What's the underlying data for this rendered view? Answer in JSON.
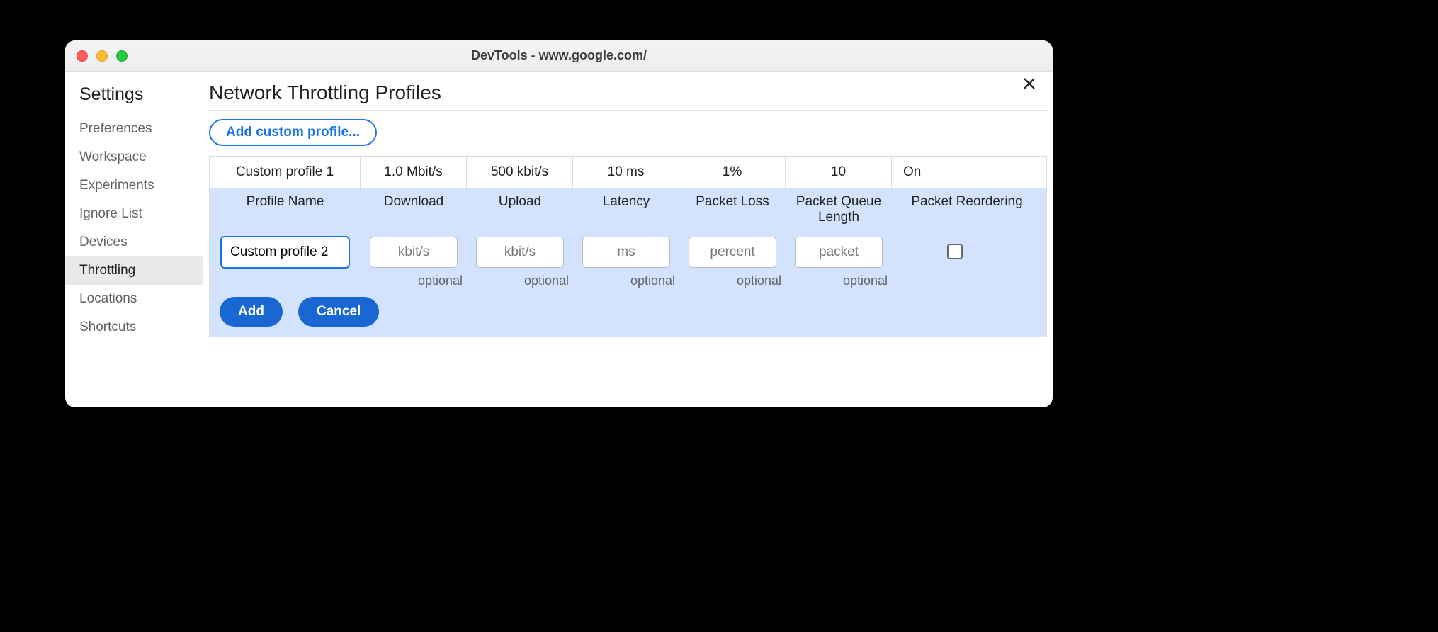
{
  "window_title": "DevTools - www.google.com/",
  "sidebar": {
    "heading": "Settings",
    "items": [
      "Preferences",
      "Workspace",
      "Experiments",
      "Ignore List",
      "Devices",
      "Throttling",
      "Locations",
      "Shortcuts"
    ],
    "active_index": 5
  },
  "page": {
    "title": "Network Throttling Profiles",
    "add_button": "Add custom profile..."
  },
  "existing_profile": {
    "name": "Custom profile 1",
    "download": "1.0 Mbit/s",
    "upload": "500 kbit/s",
    "latency": "10 ms",
    "packet_loss": "1%",
    "queue_length": "10",
    "reordering": "On"
  },
  "headers": {
    "name": "Profile Name",
    "download": "Download",
    "upload": "Upload",
    "latency": "Latency",
    "packet_loss": "Packet Loss",
    "queue_length": "Packet Queue Length",
    "reordering": "Packet Reordering"
  },
  "editor": {
    "name_value": "Custom profile 2",
    "download_placeholder": "kbit/s",
    "upload_placeholder": "kbit/s",
    "latency_placeholder": "ms",
    "packet_loss_placeholder": "percent",
    "queue_length_placeholder": "packet",
    "optional": "optional",
    "reordering_checked": false
  },
  "buttons": {
    "add": "Add",
    "cancel": "Cancel"
  }
}
